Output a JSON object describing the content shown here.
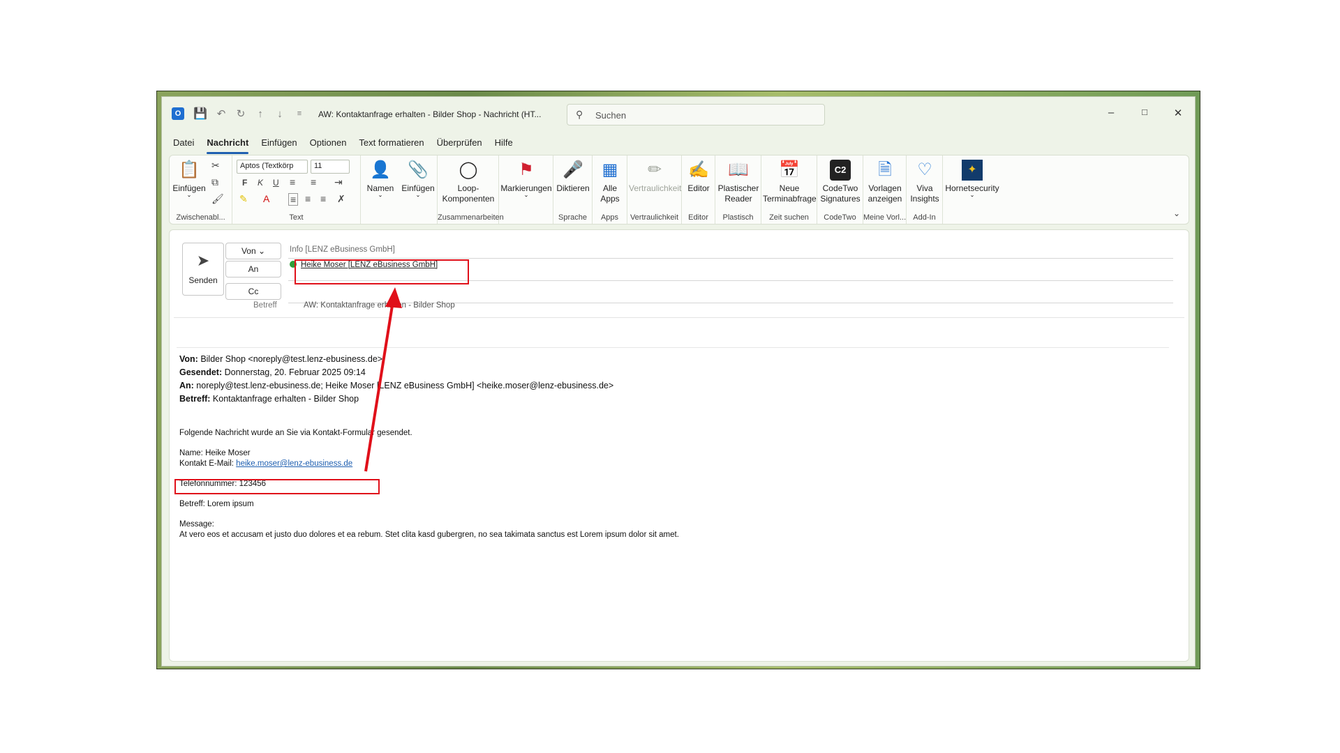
{
  "titlebar": {
    "title": "AW: Kontaktanfrage erhalten - Bilder Shop  -  Nachricht (HT...",
    "search_placeholder": "Suchen",
    "app_icon": "outlook-icon"
  },
  "menu": {
    "tabs": [
      "Datei",
      "Nachricht",
      "Einfügen",
      "Optionen",
      "Text formatieren",
      "Überprüfen",
      "Hilfe"
    ],
    "active": "Nachricht"
  },
  "ribbon": {
    "clipboard": {
      "paste": "Einfügen",
      "group": "Zwischenabl..."
    },
    "text": {
      "font": "Aptos (Textkörp",
      "size": "11",
      "bold": "F",
      "italic": "K",
      "underline": "U",
      "group": "Text"
    },
    "names": "Namen",
    "insert": "Einfügen",
    "loop_line1": "Loop-",
    "loop_line2": "Komponenten",
    "loop_group": "Zusammenarbeiten",
    "flags": "Markierungen",
    "dictate": "Diktieren",
    "dictate_group": "Sprache",
    "apps_line1": "Alle",
    "apps_line2": "Apps",
    "apps_group": "Apps",
    "sensitivity": "Vertraulichkeit",
    "sensitivity_group": "Vertraulichkeit",
    "editor": "Editor",
    "editor_group": "Editor",
    "reader_line1": "Plastischer",
    "reader_line2": "Reader",
    "reader_group": "Plastisch",
    "meeting_line1": "Neue",
    "meeting_line2": "Terminabfrage",
    "meeting_group": "Zeit suchen",
    "codetwo_line1": "CodeTwo",
    "codetwo_line2": "Signatures",
    "codetwo_group": "CodeTwo",
    "templates_line1": "Vorlagen",
    "templates_line2": "anzeigen",
    "templates_group": "Meine Vorl...",
    "viva_line1": "Viva",
    "viva_line2": "Insights",
    "viva_group": "Add-In",
    "hornet": "Hornetsecurity"
  },
  "compose": {
    "send": "Senden",
    "from_button": "Von",
    "from_value": "Info [LENZ eBusiness GmbH]",
    "to_button": "An",
    "to_value": "Heike Moser [LENZ eBusiness GmbH]",
    "cc_button": "Cc",
    "subject_label": "Betreff",
    "subject_value": "AW: Kontaktanfrage erhalten - Bilder Shop"
  },
  "body": {
    "von_label": "Von:",
    "von_value": " Bilder Shop <noreply@test.lenz-ebusiness.de>",
    "gesendet_label": "Gesendet:",
    "gesendet_value": " Donnerstag, 20. Februar 2025 09:14",
    "an_label": "An:",
    "an_value": " noreply@test.lenz-ebusiness.de; Heike Moser [LENZ eBusiness GmbH] <heike.moser@lenz-ebusiness.de>",
    "betreff_label": "Betreff:",
    "betreff_value": " Kontaktanfrage erhalten - Bilder Shop",
    "intro": "Folgende Nachricht wurde an Sie via Kontakt-Formular gesendet.",
    "name_line": "Name: Heike Moser",
    "contact_label": "Kontakt E-Mail: ",
    "contact_email": "heike.moser@lenz-ebusiness.de",
    "phone_line": "Telefonnummer: 123456",
    "subject_line": "Betreff: Lorem ipsum",
    "message_label": "Message:",
    "message_text": "At vero eos et accusam et justo duo dolores et ea rebum. Stet clita kasd gubergren, no sea takimata sanctus est Lorem ipsum dolor sit amet."
  },
  "annotation_color": "#e0101a"
}
